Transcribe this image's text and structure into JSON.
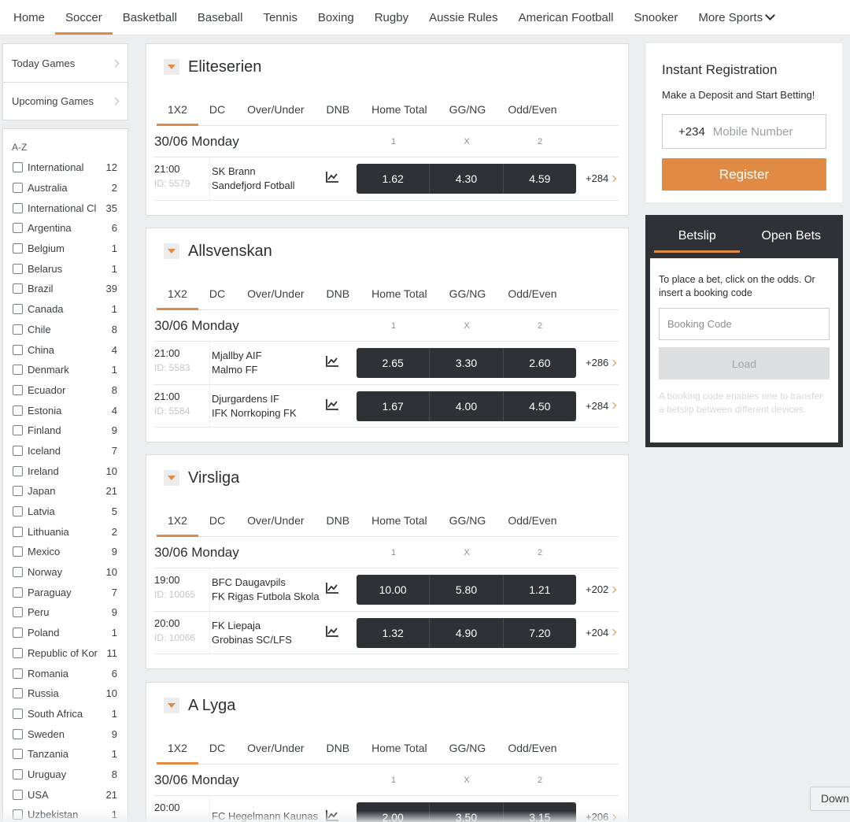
{
  "nav": {
    "items": [
      {
        "label": "Home"
      },
      {
        "label": "Soccer",
        "active": true
      },
      {
        "label": "Basketball"
      },
      {
        "label": "Baseball"
      },
      {
        "label": "Tennis"
      },
      {
        "label": "Boxing"
      },
      {
        "label": "Rugby"
      },
      {
        "label": "Aussie Rules"
      },
      {
        "label": "American Football"
      },
      {
        "label": "Snooker"
      }
    ],
    "more_label": "More Sports",
    "more_icon": "chevron-down-icon"
  },
  "quick_links": [
    {
      "label": "Today Games"
    },
    {
      "label": "Upcoming Games"
    }
  ],
  "az": {
    "title": "A-Z",
    "countries": [
      {
        "name": "International",
        "count": "12"
      },
      {
        "name": "Australia",
        "count": "2"
      },
      {
        "name": "International Cl",
        "count": "35"
      },
      {
        "name": "Argentina",
        "count": "6"
      },
      {
        "name": "Belgium",
        "count": "1"
      },
      {
        "name": "Belarus",
        "count": "1"
      },
      {
        "name": "Brazil",
        "count": "39"
      },
      {
        "name": "Canada",
        "count": "1"
      },
      {
        "name": "Chile",
        "count": "8"
      },
      {
        "name": "China",
        "count": "4"
      },
      {
        "name": "Denmark",
        "count": "1"
      },
      {
        "name": "Ecuador",
        "count": "8"
      },
      {
        "name": "Estonia",
        "count": "4"
      },
      {
        "name": "Finland",
        "count": "9"
      },
      {
        "name": "Iceland",
        "count": "7"
      },
      {
        "name": "Ireland",
        "count": "10"
      },
      {
        "name": "Japan",
        "count": "21"
      },
      {
        "name": "Latvia",
        "count": "5"
      },
      {
        "name": "Lithuania",
        "count": "2"
      },
      {
        "name": "Mexico",
        "count": "9"
      },
      {
        "name": "Norway",
        "count": "10"
      },
      {
        "name": "Paraguay",
        "count": "7"
      },
      {
        "name": "Peru",
        "count": "9"
      },
      {
        "name": "Poland",
        "count": "1"
      },
      {
        "name": "Republic of Kor",
        "count": "11"
      },
      {
        "name": "Romania",
        "count": "6"
      },
      {
        "name": "Russia",
        "count": "10"
      },
      {
        "name": "South Africa",
        "count": "1"
      },
      {
        "name": "Sweden",
        "count": "9"
      },
      {
        "name": "Tanzania",
        "count": "1"
      },
      {
        "name": "Uruguay",
        "count": "8"
      },
      {
        "name": "USA",
        "count": "21"
      },
      {
        "name": "Uzbekistan",
        "count": "1"
      }
    ]
  },
  "market_tabs": [
    "1X2",
    "DC",
    "Over/Under",
    "DNB",
    "Home Total",
    "GG/NG",
    "Odd/Even"
  ],
  "col_headers": [
    "1",
    "X",
    "2"
  ],
  "leagues": [
    {
      "name": "Eliteserien",
      "date": "30/06 Monday",
      "matches": [
        {
          "time": "21:00",
          "id": "ID: 5579",
          "home": "SK Brann",
          "away": "Sandefjord Fotball",
          "odds": [
            "1.62",
            "4.30",
            "4.59"
          ],
          "more": "+284"
        }
      ]
    },
    {
      "name": "Allsvenskan",
      "date": "30/06 Monday",
      "matches": [
        {
          "time": "21:00",
          "id": "ID: 5583",
          "home": "Mjallby AIF",
          "away": "Malmo FF",
          "odds": [
            "2.65",
            "3.30",
            "2.60"
          ],
          "more": "+286"
        },
        {
          "time": "21:00",
          "id": "ID: 5584",
          "home": "Djurgardens IF",
          "away": "IFK Norrkoping FK",
          "odds": [
            "1.67",
            "4.00",
            "4.50"
          ],
          "more": "+284"
        }
      ]
    },
    {
      "name": "Virsliga",
      "date": "30/06 Monday",
      "matches": [
        {
          "time": "19:00",
          "id": "ID: 10065",
          "home": "BFC Daugavpils",
          "away": "FK Rigas Futbola Skola",
          "odds": [
            "10.00",
            "5.80",
            "1.21"
          ],
          "more": "+202"
        },
        {
          "time": "20:00",
          "id": "ID: 10066",
          "home": "FK Liepaja",
          "away": "Grobinas SC/LFS",
          "odds": [
            "1.32",
            "4.90",
            "7.20"
          ],
          "more": "+204"
        }
      ]
    },
    {
      "name": "A Lyga",
      "date": "30/06 Monday",
      "matches": [
        {
          "time": "20:00",
          "id": "",
          "home": "FC Hegelmann Kaunas",
          "away": "",
          "odds": [
            "2.00",
            "3.50",
            "3.15"
          ],
          "more": "+206"
        }
      ]
    }
  ],
  "registration": {
    "title": "Instant Registration",
    "subtitle": "Make a Deposit and Start Betting!",
    "prefix": "+234",
    "phone_placeholder": "Mobile Number",
    "button": "Register"
  },
  "betslip": {
    "tabs": [
      {
        "label": "Betslip",
        "active": true
      },
      {
        "label": "Open Bets"
      }
    ],
    "info": "To place a bet, click on the odds. Or insert a booking code",
    "code_placeholder": "Booking Code",
    "load": "Load",
    "note": "A booking code enables one to transfer a betslip between different devices."
  },
  "down_label": "Down",
  "colors": {
    "accent": "#e08a44",
    "odds_bg": "#2e3135",
    "page_bg": "#eceef0"
  }
}
